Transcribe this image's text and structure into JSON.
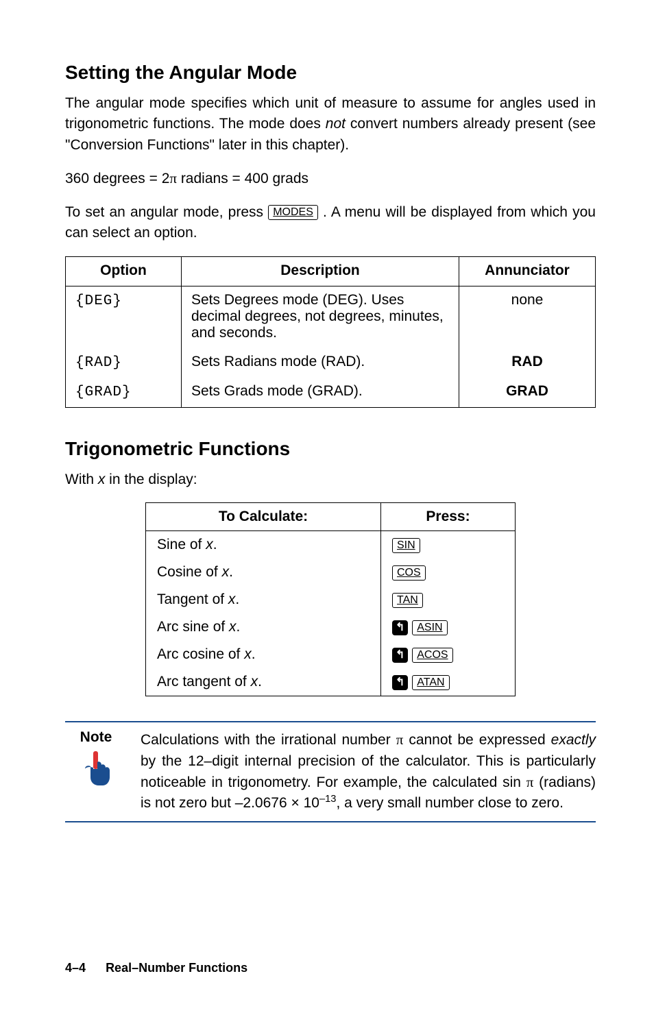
{
  "section1": {
    "heading": "Setting the Angular Mode",
    "para1_a": "The angular mode specifies which unit of measure to assume for angles used in trigonometric functions. The mode does ",
    "para1_not": "not",
    "para1_b": " convert numbers already present (see \"Conversion Functions\" later in this chapter).",
    "equation_a": "360 degrees = 2",
    "equation_pi": "π",
    "equation_b": " radians = 400 grads",
    "para2_a": "To set an angular mode, press ",
    "para2_key": "MODES",
    "para2_b": " . A menu will be displayed from which you can select an option.",
    "table": {
      "headers": [
        "Option",
        "Description",
        "Annunciator"
      ],
      "rows": [
        {
          "option": "{DEG}",
          "desc": "Sets Degrees mode (DEG). Uses decimal degrees, not degrees, minutes, and seconds.",
          "ann": "none",
          "ann_bold": false
        },
        {
          "option": "{RAD}",
          "desc": "Sets Radians mode (RAD).",
          "ann": "RAD",
          "ann_bold": true
        },
        {
          "option": "{GRAD}",
          "desc": "Sets Grads mode (GRAD).",
          "ann": "GRAD",
          "ann_bold": true
        }
      ]
    }
  },
  "section2": {
    "heading": "Trigonometric Functions",
    "intro_a": "With ",
    "intro_x": "x",
    "intro_b": " in the display:",
    "table": {
      "headers": [
        "To Calculate:",
        "Press:"
      ],
      "rows": [
        {
          "calc_a": "Sine of ",
          "calc_x": "x",
          "calc_b": ".",
          "shift": false,
          "key": "SIN"
        },
        {
          "calc_a": "Cosine of ",
          "calc_x": "x",
          "calc_b": ".",
          "shift": false,
          "key": "COS"
        },
        {
          "calc_a": "Tangent of ",
          "calc_x": "x",
          "calc_b": ".",
          "shift": false,
          "key": "TAN"
        },
        {
          "calc_a": "Arc sine of ",
          "calc_x": "x",
          "calc_b": ".",
          "shift": true,
          "key": "ASIN"
        },
        {
          "calc_a": "Arc cosine of ",
          "calc_x": "x",
          "calc_b": ".",
          "shift": true,
          "key": "ACOS"
        },
        {
          "calc_a": "Arc tangent of ",
          "calc_x": "x",
          "calc_b": ".",
          "shift": true,
          "key": "ATAN"
        }
      ]
    }
  },
  "note": {
    "label": "Note",
    "text_a": "Calculations with the irrational number ",
    "text_pi": "π",
    "text_b": " cannot be expressed ",
    "text_exactly": "exactly",
    "text_c": " by the 12–digit internal precision of the calculator. This is particularly noticeable in trigonometry. For example, the calculated sin ",
    "text_pi2": "π",
    "text_d": " (radians) is not zero but –2.0676 × 10",
    "text_exp": "–13",
    "text_e": ", a very small number close to zero."
  },
  "footer": {
    "page": "4–4",
    "chapter": "Real–Number Functions"
  },
  "icons": {
    "shift_glyph": "↰"
  }
}
